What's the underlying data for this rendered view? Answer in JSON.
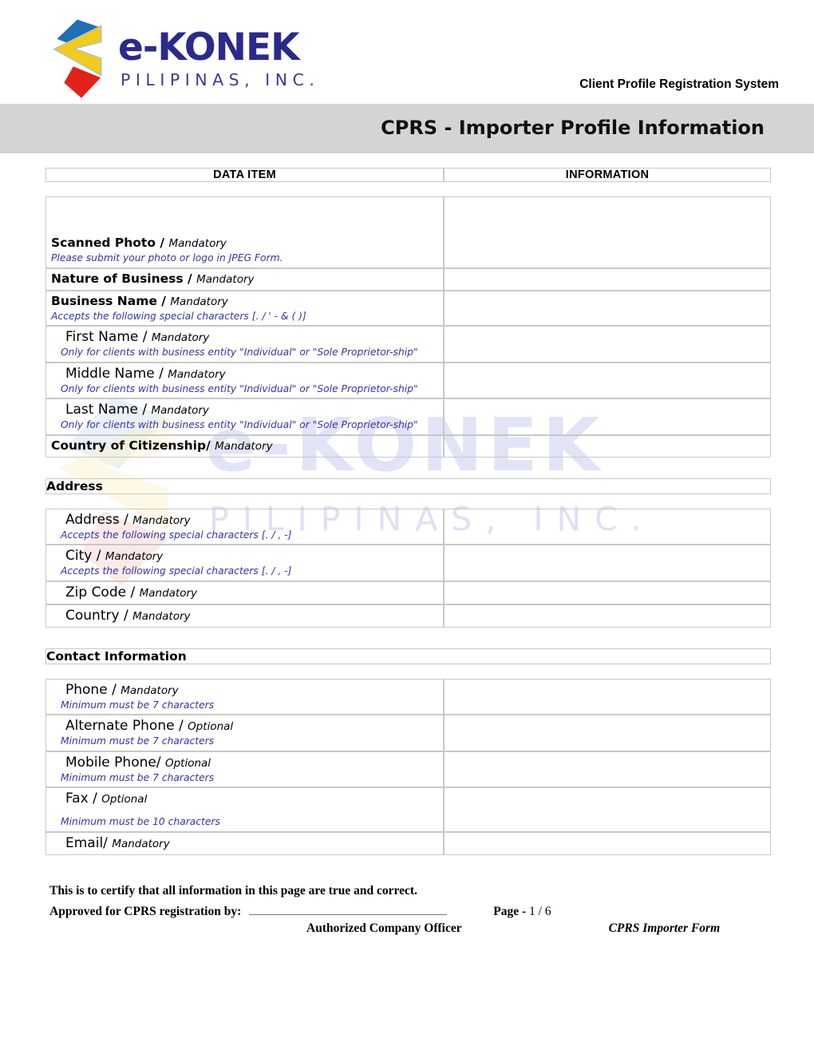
{
  "brand": {
    "logo_main": "e-KONEK",
    "logo_sub": "PILIPINAS, INC.",
    "watermark_main": "e-KONEK",
    "watermark_sub": "PILIPINAS, INC.",
    "colors": {
      "logo_blue": "#2a2a8c",
      "mark_blue": "#1f6fb5",
      "mark_yellow": "#f2cb1d",
      "mark_red": "#e32119",
      "title_bar": "#d4d4d4",
      "hint_blue": "#3333aa"
    }
  },
  "header": {
    "system_title": "Client Profile Registration System",
    "document_title": "CPRS - Importer Profile Information"
  },
  "table": {
    "columns": [
      "DATA ITEM",
      "INFORMATION"
    ],
    "sections": [
      {
        "id": "business",
        "heading": null,
        "rows": [
          {
            "id": "scanned-photo",
            "label": "Scanned Photo",
            "separator": " / ",
            "qualifier": "Mandatory",
            "hint": "Please submit your photo or logo in JPEG Form.",
            "style": "bold",
            "tall": true
          },
          {
            "id": "nature-of-business",
            "label": "Nature of Business",
            "separator": " / ",
            "qualifier": "Mandatory",
            "hint": null,
            "style": "bold"
          },
          {
            "id": "business-name",
            "label": "Business Name",
            "separator": " / ",
            "qualifier": "Mandatory",
            "hint": "Accepts the following special characters [. / ' - & ( )]",
            "style": "bold"
          },
          {
            "id": "first-name",
            "label": "First Name",
            "separator": " / ",
            "qualifier": "Mandatory",
            "hint": "Only for clients with business entity \"Individual\" or \"Sole Proprietor-ship\"",
            "style": "plain-indent"
          },
          {
            "id": "middle-name",
            "label": "Middle Name",
            "separator": " / ",
            "qualifier": "Mandatory",
            "hint": "Only for clients with business entity \"Individual\" or \"Sole Proprietor-ship\"",
            "style": "plain-indent"
          },
          {
            "id": "last-name",
            "label": "Last Name",
            "separator": " / ",
            "qualifier": "Mandatory",
            "hint": "Only for clients with business entity \"Individual\" or \"Sole Proprietor-ship\"",
            "style": "plain-indent"
          },
          {
            "id": "country-of-citizenship",
            "label": "Country of Citizenship",
            "separator": "/ ",
            "qualifier": "Mandatory",
            "hint": null,
            "style": "bold"
          }
        ]
      },
      {
        "id": "address",
        "heading": "Address",
        "rows": [
          {
            "id": "address",
            "label": "Address",
            "separator": " / ",
            "qualifier": "Mandatory",
            "hint": "Accepts the following special characters [. / , -]",
            "style": "plain-indent"
          },
          {
            "id": "city",
            "label": "City",
            "separator": " / ",
            "qualifier": "Mandatory",
            "hint": "Accepts the following special characters [. / , -]",
            "style": "plain-indent"
          },
          {
            "id": "zip-code",
            "label": "Zip Code",
            "separator": " / ",
            "qualifier": "Mandatory",
            "hint": null,
            "style": "plain-indent"
          },
          {
            "id": "country",
            "label": "Country",
            "separator": " / ",
            "qualifier": "Mandatory",
            "hint": null,
            "style": "plain-indent"
          }
        ]
      },
      {
        "id": "contact-information",
        "heading": "Contact Information",
        "rows": [
          {
            "id": "phone",
            "label": "Phone",
            "separator": " / ",
            "qualifier": "Mandatory",
            "hint": "Minimum must be 7 characters",
            "style": "plain-indent"
          },
          {
            "id": "alternate-phone",
            "label": "Alternate Phone",
            "separator": " / ",
            "qualifier": "Optional",
            "hint": "Minimum must be 7 characters",
            "style": "plain-indent"
          },
          {
            "id": "mobile-phone",
            "label": "Mobile Phone",
            "separator": "/ ",
            "qualifier": "Optional",
            "hint": "Minimum must be 7 characters",
            "style": "plain-indent"
          },
          {
            "id": "fax",
            "label": "Fax",
            "separator": " / ",
            "qualifier": "Optional",
            "hint": "Minimum must be 10 characters",
            "style": "plain-indent",
            "extra_gap": true
          },
          {
            "id": "email",
            "label": "Email",
            "separator": "/ ",
            "qualifier": "Mandatory",
            "hint": null,
            "style": "plain-indent"
          }
        ]
      }
    ]
  },
  "footer": {
    "certification": "This is to certify that all information in this page are true and correct.",
    "approved_by": "Approved for CPRS registration by:",
    "officer_caption": "Authorized Company Officer",
    "page_label": "Page - ",
    "page_value": "1 / 6",
    "form_name": "CPRS Importer Form"
  }
}
